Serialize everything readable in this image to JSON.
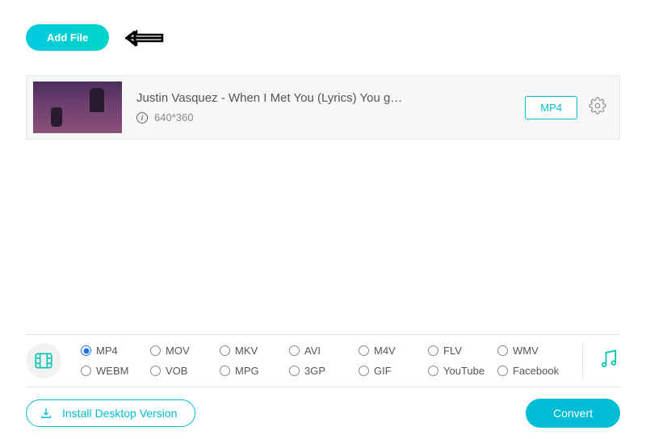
{
  "toolbar": {
    "add_file_label": "Add File"
  },
  "file": {
    "title": "Justin Vasquez - When I Met You (Lyrics) You g…",
    "resolution": "640*360",
    "format_badge": "MP4"
  },
  "formats": {
    "selected": "MP4",
    "row1": [
      "MP4",
      "MOV",
      "MKV",
      "AVI",
      "M4V",
      "FLV",
      "WMV"
    ],
    "row2": [
      "WEBM",
      "VOB",
      "MPG",
      "3GP",
      "GIF",
      "YouTube",
      "Facebook"
    ]
  },
  "footer": {
    "install_label": "Install Desktop Version",
    "convert_label": "Convert"
  }
}
